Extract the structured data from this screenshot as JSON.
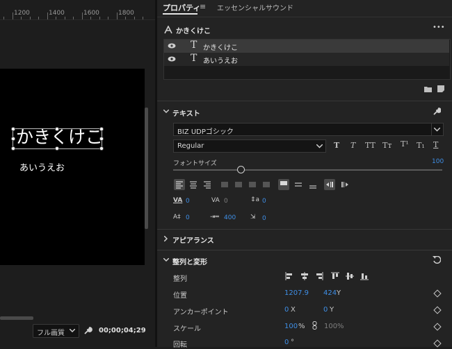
{
  "ruler": {
    "ticks": [
      "1200",
      "1400",
      "1600",
      "1800"
    ]
  },
  "canvas": {
    "text1": "かきくけこ",
    "text2": "あいうえお"
  },
  "bottom": {
    "resolution": "フル画質",
    "timecode": "00;00;04;29"
  },
  "tabs": {
    "properties": "プロパティ",
    "essential_sound": "エッセンシャルサウンド"
  },
  "object": {
    "name": "かきくけこ",
    "more": "•••"
  },
  "layers": [
    {
      "name": "かきくけこ"
    },
    {
      "name": "あいうえお"
    }
  ],
  "text_section": {
    "title": "テキスト",
    "font": "BIZ UDPゴシック",
    "style": "Regular",
    "font_size_label": "フォントサイズ",
    "font_size_value": "100",
    "slider_fraction": 0.25,
    "kerning": "0",
    "tracking": "0",
    "baseline": "0",
    "leading": "0",
    "tsume": "400",
    "tab_width": "0"
  },
  "appearance_section": {
    "title": "アピアランス"
  },
  "align_section": {
    "title": "整列と変形",
    "align_label": "整列",
    "position_label": "位置",
    "position_x": "1207.9",
    "position_y": "424",
    "position_y_unit": "Y",
    "anchor_label": "アンカーポイント",
    "anchor_x": "0",
    "anchor_x_unit": "X",
    "anchor_y": "0",
    "anchor_y_unit": "Y",
    "scale_label": "スケール",
    "scale_value": "100",
    "scale_unit": "%",
    "scale2_value": "100",
    "scale2_unit": "%",
    "rotation_label": "回転",
    "rotation_value": "0",
    "rotation_unit": "°"
  },
  "colors": {
    "accent": "#3f8fe6",
    "panel": "#232323",
    "canvas": "#000000"
  }
}
